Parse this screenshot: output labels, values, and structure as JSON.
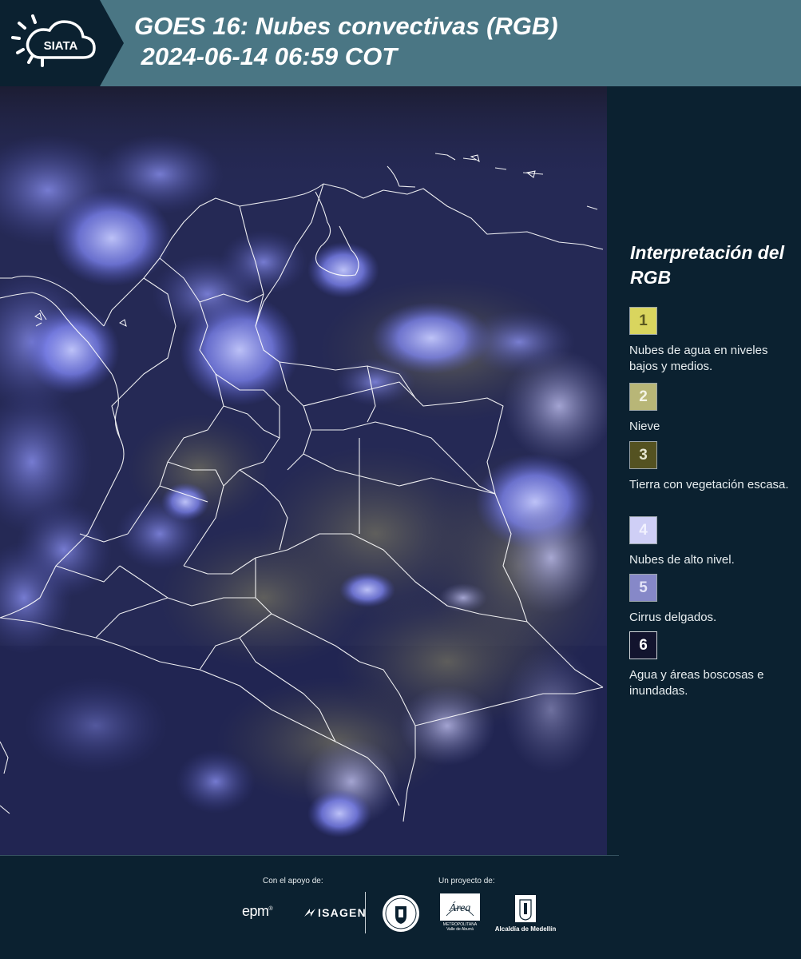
{
  "header": {
    "title_line1": "GOES 16: Nubes convectivas (RGB)",
    "title_line2": " 2024-06-14 06:59 COT",
    "logo_text": "SIATA"
  },
  "legend": {
    "title": "Interpretación del RGB",
    "items": [
      {
        "num": "1",
        "label": "Nubes de agua en niveles bajos y medios.",
        "color": "#d9d55e"
      },
      {
        "num": "2",
        "label": "Nieve",
        "color": "#b8b677"
      },
      {
        "num": "3",
        "label": "Tierra con vegetación escasa.",
        "color": "#545221"
      },
      {
        "num": "4",
        "label": "Nubes de alto nivel.",
        "color": "#cfcff6"
      },
      {
        "num": "5",
        "label": "Cirrus delgados.",
        "color": "#8688c8"
      },
      {
        "num": "6",
        "label": "Agua y áreas boscosas e inundadas.",
        "color": "#12142e"
      }
    ]
  },
  "footer": {
    "support_label": "Con el apoyo de:",
    "project_label": "Un proyecto de:",
    "epm": "epm",
    "isagen": "ISAGEN",
    "area_logo": "Área",
    "area_sub": "METROPOLITANA Valle de Aburrá",
    "alcaldia": "Alcaldía de Medellín"
  },
  "colors": {
    "header_bg": "#4a7684",
    "panel_bg": "#0b2130",
    "map_bg": "#262a55",
    "cloud_high": "#7d87ff",
    "border_lines": "#ffffff"
  }
}
